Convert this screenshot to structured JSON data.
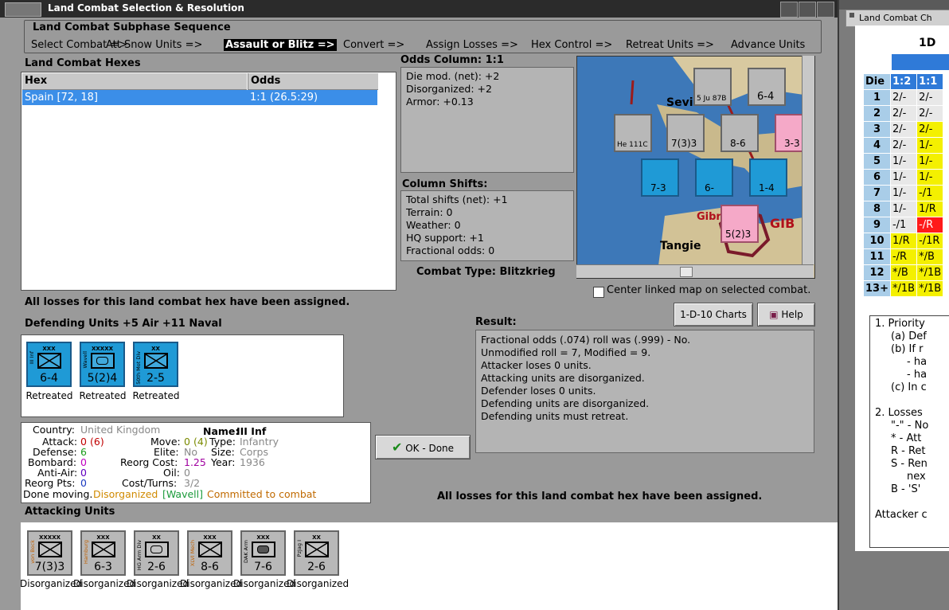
{
  "window": {
    "title": "Land Combat Selection & Resolution"
  },
  "subphase": {
    "legend": "Land Combat Subphase Sequence",
    "steps": [
      "Select Combat =>",
      "Att Snow Units =>",
      "Assault or Blitz =>",
      "Convert =>",
      "Assign Losses =>",
      "Hex Control =>",
      "Retreat Units =>",
      "Advance Units"
    ],
    "active_index": 2
  },
  "hexes": {
    "label": "Land Combat Hexes",
    "col_hex": "Hex",
    "col_odds": "Odds",
    "rows": [
      {
        "hex": "Spain [72, 18]",
        "odds": "1:1 (26.5:29)"
      }
    ]
  },
  "odds": {
    "label": "Odds Column: 1:1",
    "lines": [
      "Die mod. (net): +2",
      "Disorganized: +2",
      "Armor: +0.13"
    ]
  },
  "shifts": {
    "label": "Column Shifts:",
    "lines": [
      "Total shifts (net): +1",
      "Terrain: 0",
      "Weather: 0",
      "HQ support: +1",
      "Fractional odds: 0"
    ]
  },
  "combat_type": "Combat Type:  Blitzkrieg",
  "center_map_label": "Center linked map on selected combat.",
  "losses_msg": "All losses for this land combat hex have been assigned.",
  "defending": {
    "label": "Defending Units +5 Air +11 Naval",
    "units": [
      {
        "name": "III Inf",
        "type": "XXX",
        "vals": "6-4",
        "status": "Retreated"
      },
      {
        "name": "Wavell",
        "type": "XXXXX",
        "vals": "5(2)4",
        "status": "Retreated"
      },
      {
        "name": "50th Mot Div",
        "type": "XX",
        "vals": "2-5",
        "status": "Retreated"
      }
    ]
  },
  "unitinfo": {
    "country_label": "Country:",
    "country": "United Kingdom",
    "name_label": "Name:",
    "name": "III Inf",
    "attack_label": "Attack:",
    "attack": "0",
    "attack_paren": "(6)",
    "move_label": "Move:",
    "move": "0",
    "move_paren": "(4)",
    "type_label": "Type:",
    "type": "Infantry",
    "defense_label": "Defense:",
    "defense": "6",
    "elite_label": "Elite:",
    "elite": "No",
    "size_label": "Size:",
    "size": "Corps",
    "bombard_label": "Bombard:",
    "bombard": "0",
    "reorg_label": "Reorg Cost:",
    "reorg": "1.25",
    "year_label": "Year:",
    "year": "1936",
    "antiair_label": "Anti-Air:",
    "antiair": "0",
    "oil_label": "Oil:",
    "oil": "0",
    "reorgpts_label": "Reorg Pts:",
    "reorgpts": "0",
    "costturns_label": "Cost/Turns:",
    "costturns": "3/2",
    "status_done": "Done moving.",
    "status_disorg": "Disorganized",
    "status_hq": "[Wavell]",
    "status_committed": "Committed to combat"
  },
  "ok_button": "OK - Done",
  "charts_button": "1-D-10 Charts",
  "help_button": "Help",
  "result": {
    "label": "Result:",
    "lines": [
      "Fractional odds (.074) roll was (.999)  - No.",
      "Unmodified roll = 7, Modified = 9.",
      "Attacker loses 0 units.",
      "Attacking units are disorganized.",
      "Defender loses 0 units.",
      "Defending units are disorganized.",
      "Defending units must retreat."
    ]
  },
  "attacking": {
    "label": "Attacking Units",
    "units": [
      {
        "name": "von Bock",
        "type": "XXXXX",
        "vals": "7(3)3",
        "status": "Disorganized"
      },
      {
        "name": "Hamburg",
        "type": "XXX",
        "vals": "6-3",
        "status": "Disorganized"
      },
      {
        "name": "HG Arm Div",
        "type": "XX",
        "vals": "2-6",
        "status": "Disorganized"
      },
      {
        "name": "XLVI Mech",
        "type": "XXX",
        "vals": "8-6",
        "status": "Disorganized"
      },
      {
        "name": "DAK Arm",
        "type": "XXX",
        "vals": "7-6",
        "status": "Disorganized"
      },
      {
        "name": "PzJag I",
        "type": "XX",
        "vals": "2-6",
        "status": "Disorganized"
      }
    ]
  },
  "map": {
    "labels": [
      "Sevi",
      "Gibr",
      "GIB",
      "Tangie"
    ],
    "counters": [
      "5 Ju 87B",
      "6-4",
      "He 111C",
      "7(3)3",
      "8-6",
      "3-3",
      "7-3",
      "6-",
      "1-4",
      "5(2)3"
    ]
  },
  "rightwin": {
    "title": "Land Combat Ch",
    "heading": "1D",
    "cols": [
      "Die",
      "1:2",
      "1:1"
    ],
    "rows": [
      [
        "1",
        "2/-",
        "2/-"
      ],
      [
        "2",
        "2/-",
        "2/-"
      ],
      [
        "3",
        "2/-",
        "2/-"
      ],
      [
        "4",
        "2/-",
        "1/-"
      ],
      [
        "5",
        "1/-",
        "1/-"
      ],
      [
        "6",
        "1/-",
        "1/-"
      ],
      [
        "7",
        "1/-",
        "-/1"
      ],
      [
        "8",
        "1/-",
        "1/R"
      ],
      [
        "9",
        "-/1",
        "-/R"
      ],
      [
        "10",
        "1/R",
        "-/1R"
      ],
      [
        "11",
        "-/R",
        "*/B"
      ],
      [
        "12",
        "*/B",
        "*/1B"
      ],
      [
        "13+",
        "*/1B",
        "*/1B"
      ]
    ],
    "notes": [
      "1. Priority",
      "(a) Def",
      "(b) If r",
      "- ha",
      "- ha",
      "(c) In c",
      "2. Losses",
      "\"-\" - No",
      "* - Att",
      "R - Ret",
      "S - Ren",
      "nex",
      "B - 'S'",
      "Attacker c"
    ]
  }
}
